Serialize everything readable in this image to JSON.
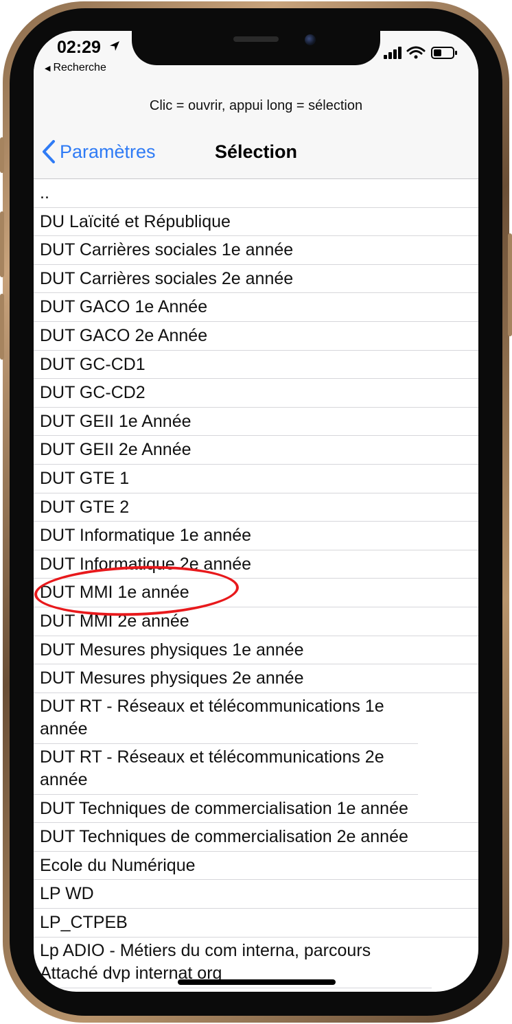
{
  "status_bar": {
    "time": "02:29",
    "back_app_label": "Recherche",
    "icons": [
      "location-arrow-icon",
      "cellular-signal-icon",
      "wifi-icon",
      "battery-icon"
    ]
  },
  "header": {
    "hint": "Clic = ouvrir, appui long = sélection",
    "back_label": "Paramètres",
    "title": "Sélection"
  },
  "list": {
    "items": [
      "..",
      "DU Laïcité et République",
      "DUT Carrières sociales 1e année",
      "DUT Carrières sociales 2e année",
      "DUT GACO 1e Année",
      "DUT GACO 2e Année",
      "DUT GC-CD1",
      "DUT GC-CD2",
      "DUT GEII 1e Année",
      "DUT GEII 2e Année",
      "DUT GTE 1",
      "DUT GTE 2",
      "DUT Informatique 1e année",
      "DUT Informatique 2e année",
      "DUT MMI 1e année",
      "DUT MMI 2e année",
      "DUT Mesures physiques 1e année",
      "DUT Mesures physiques 2e année",
      "DUT RT - Réseaux et télécommunications 1e année",
      "DUT RT - Réseaux et télécommunications 2e année",
      "DUT Techniques de commercialisation 1e année",
      "DUT Techniques de commercialisation 2e année",
      "Ecole du Numérique",
      "LP WD",
      "LP_CTPEB",
      "Lp ADIO - Métiers du com interna, parcours Attaché dvp internat org"
    ]
  },
  "colors": {
    "accent": "#2f7bf5",
    "highlight": "#e8191c",
    "frame": "#b8946c"
  }
}
